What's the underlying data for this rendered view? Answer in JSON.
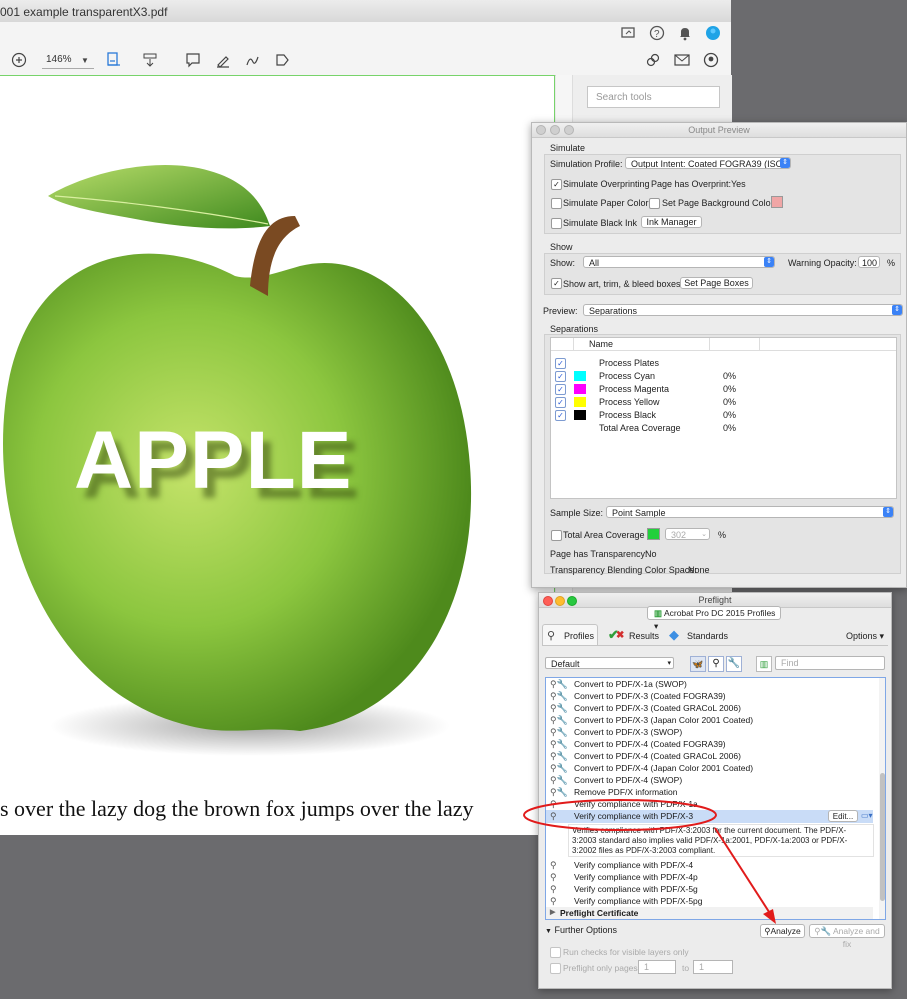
{
  "acrobat": {
    "title": "001 example transparentX3.pdf",
    "zoom": "146%",
    "search_placeholder": "Search tools",
    "apple_text": "APPLE",
    "caption": "s over the lazy dog the brown fox jumps over the lazy"
  },
  "output_preview": {
    "title": "Output Preview",
    "simulate_header": "Simulate",
    "simulation_profile_label": "Simulation Profile:",
    "simulation_profile_value": "Output Intent: Coated FOGRA39 (ISO 12...",
    "simulate_overprinting": "Simulate Overprinting",
    "page_has_overprint_label": "Page has Overprint:",
    "page_has_overprint_value": "Yes",
    "simulate_paper_color": "Simulate Paper Color",
    "set_page_bg_color": "Set Page Background Color",
    "simulate_black_ink": "Simulate Black Ink",
    "ink_manager": "Ink Manager",
    "show_header": "Show",
    "show_label": "Show:",
    "show_value": "All",
    "warning_opacity_label": "Warning Opacity:",
    "warning_opacity_value": "100",
    "percent": "%",
    "show_boxes": "Show art, trim, & bleed boxes",
    "set_page_boxes": "Set Page Boxes",
    "preview_label": "Preview:",
    "preview_value": "Separations",
    "separations_header": "Separations",
    "name_col": "Name",
    "separations": [
      {
        "name": "Process Plates",
        "value": "",
        "color": ""
      },
      {
        "name": "Process Cyan",
        "value": "0%",
        "color": "#00ffff"
      },
      {
        "name": "Process Magenta",
        "value": "0%",
        "color": "#ff00ff"
      },
      {
        "name": "Process Yellow",
        "value": "0%",
        "color": "#ffff00"
      },
      {
        "name": "Process Black",
        "value": "0%",
        "color": "#000000"
      },
      {
        "name": "Total Area Coverage",
        "value": "0%",
        "color": ""
      }
    ],
    "sample_size_label": "Sample Size:",
    "sample_size_value": "Point Sample",
    "total_area_coverage": "Total Area Coverage",
    "tac_value": "302",
    "page_has_transparency_label": "Page has Transparency:",
    "page_has_transparency_value": "No",
    "blending_label": "Transparency Blending Color Space:",
    "blending_value": "None"
  },
  "preflight": {
    "title": "Preflight",
    "profiles_dropdown": "Acrobat Pro DC 2015 Profiles",
    "tab_profiles": "Profiles",
    "tab_results": "Results",
    "tab_standards": "Standards",
    "options": "Options",
    "default_value": "Default",
    "find_placeholder": "Find",
    "items": [
      {
        "label": "Convert to PDF/X-1a (SWOP)",
        "dim": false
      },
      {
        "label": "Convert to PDF/X-3 (Coated FOGRA39)",
        "dim": false
      },
      {
        "label": "Convert to PDF/X-3 (Coated GRACoL 2006)",
        "dim": false
      },
      {
        "label": "Convert to PDF/X-3 (Japan Color 2001 Coated)",
        "dim": false
      },
      {
        "label": "Convert to PDF/X-3 (SWOP)",
        "dim": false
      },
      {
        "label": "Convert to PDF/X-4 (Coated FOGRA39)",
        "dim": false
      },
      {
        "label": "Convert to PDF/X-4 (Coated GRACoL 2006)",
        "dim": false
      },
      {
        "label": "Convert to PDF/X-4 (Japan Color 2001 Coated)",
        "dim": false
      },
      {
        "label": "Convert to PDF/X-4 (SWOP)",
        "dim": false
      },
      {
        "label": "Remove PDF/X information",
        "dim": false
      },
      {
        "label": "Verify compliance with PDF/X-1a",
        "dim": false
      }
    ],
    "selected_item": "Verify compliance with PDF/X-3",
    "edit_button": "Edit...",
    "description": "Verifies compliance with PDF/X-3:2003 for the current document. The PDF/X-3:2003 standard also implies valid PDF/X-1a:2001, PDF/X-1a:2003 or PDF/X-3:2002 files as PDF/X-3:2003 compliant.",
    "items_after": [
      {
        "label": "Verify compliance with PDF/X-4"
      },
      {
        "label": "Verify compliance with PDF/X-4p"
      },
      {
        "label": "Verify compliance with PDF/X-5g"
      },
      {
        "label": "Verify compliance with PDF/X-5pg"
      }
    ],
    "certificate": "Preflight Certificate",
    "further_options": "Further Options",
    "analyze": "Analyze",
    "analyze_fix": "Analyze and fix",
    "run_visible": "Run checks for visible layers only",
    "pages_only": "Preflight only pages",
    "page_from": "1",
    "page_to_label": "to",
    "page_to": "1"
  },
  "colors": {
    "apple_green": "#8cc63f",
    "annotation_red": "#e11b1b",
    "selection_blue": "#c9dcf7"
  }
}
